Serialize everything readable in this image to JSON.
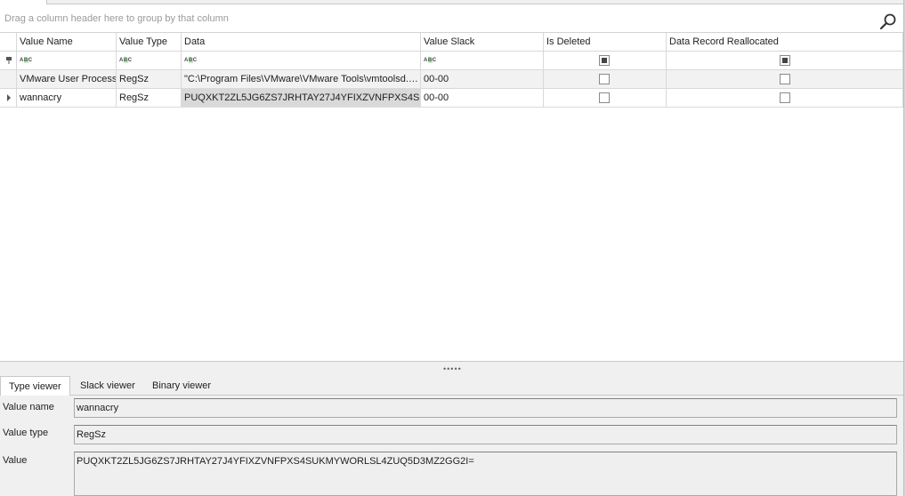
{
  "group_panel": {
    "hint": "Drag a column header here to group by that column",
    "search_icon": "search-icon"
  },
  "columns": [
    "Value Name",
    "Value Type",
    "Data",
    "Value Slack",
    "Is Deleted",
    "Data Record Reallocated"
  ],
  "filter_row": {
    "text_filter_icon": "abc-filter-icon",
    "text_filter_glyph": "ABC"
  },
  "rows": [
    {
      "value_name": "VMware User Process",
      "value_type": "RegSz",
      "data": "\"C:\\Program Files\\VMware\\VMware Tools\\vmtoolsd.…",
      "value_slack": "00-00",
      "is_deleted": false,
      "data_record_reallocated": false
    },
    {
      "value_name": "wannacry",
      "value_type": "RegSz",
      "data": "PUQXKT2ZL5JG6ZS7JRHTAY27J4YFIXZVNFPXS4SUK…",
      "value_slack": "00-00",
      "is_deleted": false,
      "data_record_reallocated": false
    }
  ],
  "splitter": {
    "grip": "•••••"
  },
  "tabs": [
    "Type viewer",
    "Slack viewer",
    "Binary viewer"
  ],
  "active_tab": "Type viewer",
  "details": {
    "value_name_label": "Value name",
    "value_name": "wannacry",
    "value_type_label": "Value type",
    "value_type": "RegSz",
    "value_label": "Value",
    "value": "PUQXKT2ZL5JG6ZS7JRHTAY27J4YFIXZVNFPXS4SUKMYWORLSL4ZUQ5D3MZ2GG2I="
  },
  "colors": {
    "selected_cell": "#d9d9d9",
    "alt_row": "#f2f2f2",
    "panel_bg": "#f0f0f0",
    "grid_line": "#d9d9d9"
  }
}
